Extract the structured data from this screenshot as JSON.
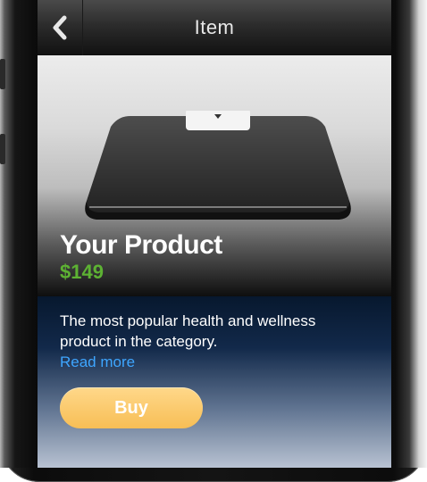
{
  "navbar": {
    "title": "Item",
    "back_icon": "chevron-left-icon"
  },
  "product": {
    "name": "Your Product",
    "price": "$149",
    "image_icon": "bathroom-scale-icon"
  },
  "details": {
    "description": "The most popular health and wellness product in the category.",
    "read_more_label": "Read more",
    "buy_label": "Buy"
  },
  "colors": {
    "price": "#5db233",
    "link": "#3ea6ff",
    "buy_button": "#f7be55"
  }
}
